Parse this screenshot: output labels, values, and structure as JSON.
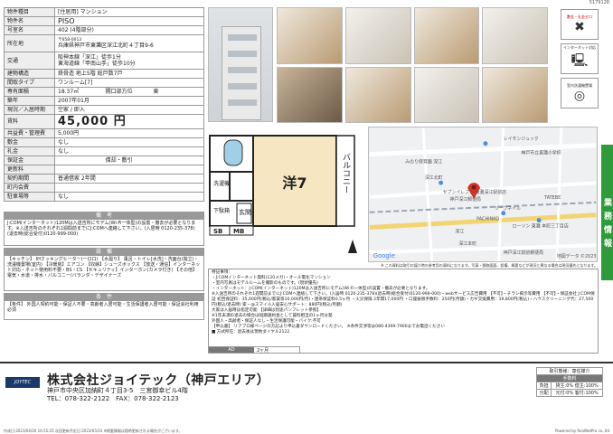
{
  "doc_code": "5179128",
  "spec": {
    "type_label": "物件種目",
    "type_value": "[住居用] マンション",
    "name_label": "物件名",
    "name_value": "PISO",
    "room_label": "号室名",
    "room_value": "402 (4階部分)",
    "address_label": "所在地",
    "postcode": "〒658-0013",
    "address_value": "兵庫県神戸市東灘区深江北町４丁目9-6",
    "access_label": "交通",
    "access_1": "阪神本線「深江」徒歩1分",
    "access_2": "東海道線「甲南山手」徒歩10分",
    "structure_label": "建物構造",
    "structure_value": "鉄骨造 地上5階 総戸数7戸",
    "layout_label": "間取タイプ",
    "layout_value": "ワンルーム[7]",
    "area_label": "専有面積",
    "area_value": "18.37㎡",
    "direction_label": "開口部方位",
    "direction_value": "東",
    "built_label": "築年",
    "built_value": "2007年01月",
    "status_label": "現況／入居時期",
    "status_value": "空家 / 即入",
    "rent_label": "賃料",
    "rent_value": "45,000 円",
    "fee_label": "共益費・管理費",
    "fee_value": "5,000円",
    "deposit_label": "敷金",
    "deposit_value": "なし",
    "key_label": "礼金",
    "key_value": "なし",
    "guarantee_label": "保証金",
    "offset_label": "償却・敷引",
    "renew_label": "更新料",
    "contract_label": "契約期間",
    "contract_value": "普通借家 2年間",
    "town_label": "町内会費",
    "parking_label": "駐車場等",
    "parking_value": "なし"
  },
  "notes": {
    "title": "備　考",
    "text": "J:COM(インターネット)120Mは入送吉所にモデム(Wi-Fi一体型)の設置・撤去が必要となります。※入送吉所のそれぞれ1週間前までにJ:COMへ連絡して下さい。(入居時 0120-235-378)(退去時(総合受付)0120-999-000)"
  },
  "equipment": {
    "title": "設　備",
    "text": "【キッチン】 IHクッキングヒーター(一口口) 【水廻り】 風呂・トイレ[水洗]・洗面台(独立)・洗濯機置場(室内) 【冷暖房】エアコン 【収納】シューズボックス 【放送・通信】インターネット対応・ネット使用料不要・BS・CS 【セキュリティ】インターホン(カメラ付き) 【その他】電気・水道・排水・バルコニー/バランダ・デザイナーズ"
  },
  "conditions": {
    "title": "条　件",
    "text": "【条件】 外国人契約可能・保証人不要・高齢者入居可能・生活保護者入居可能・保証会社利用必須"
  },
  "badges": {
    "deposit_key": "敷金・礼金ゼロ",
    "internet": "インターネット対応",
    "laundry": "室内洗濯機置場"
  },
  "side_tab": "業務情報",
  "plan": {
    "room": "洋7",
    "balcony": "バルコニー",
    "storage": "洗濯機",
    "closet": "下駄箱",
    "entrance": "玄関",
    "sb": "SB",
    "mb": "MB"
  },
  "map": {
    "labels": [
      "レイモンジュック",
      "神戸市立東灘小学校",
      "みのり保育園 深江",
      "深江北町",
      "セブンイレブン 東灘深江駅前店",
      "神戸深江郵便局",
      "リーブネイル",
      "PACHINKO",
      "深江",
      "ローソン 東灘 本町三丁目店",
      "TATEBE",
      "深江本町",
      "神戸深江駅前郵便局",
      "Google",
      "地図データ ©2023"
    ],
    "note": "※ この資料は取引の媒介時の参考用の資料になります。写真・間取図面、設備、概要などが現況と異なる場合は現況優先となります。"
  },
  "remarks": {
    "title": "特記事項：",
    "lines": [
      "・J:COMインターネット無料(120メガ)・オール電化マンション",
      "・室内写真はモデルルームを撮影のものです。(現状優先)",
      "・インターネット：J:COM(インターネット)120Mは入送吉所にモデム(Wi-Fi一体型)の設置・撤去が必要となります。",
      "※入送吉所のそれぞれ1週間前までにJ:COMへ連絡して下さい。(入居時 0120-235-378)(退去時(総合受付)0120-999-000)・webサービス広告費用 【不可】・チラシ掲示等費用 【不可】・保証会社 J:COM保証 初回保証料：35,000円(税込/家賃等10,000円/月)・連帯保証料0.5ヶ月 ・火災保険 2年間17,000円 ・口座振替手数料：250円(月額)・カギ交換費用：19,800円(税込)・ハウスクリーニング代：27,500円(税込/退去時) 家・@スマイル入居安心サポート：880円(税込/月額)",
      "大家は入居時は指定可能 【詳細は別途パンフレット参照】",
      "※1年未満の退去の場合は短期違約金として賃料相当の1ヶ月分発",
      "外国人・高齢者・保証人なし・生活保護可能・バイク:不可",
      "【申込書】 リアプロ様ページの方記より申込書ダウンロードください。 ※条件交渉等は080-4399-7900までお電話ください",
      "■ 方式所在：退去後は現地ダイヤル2122"
    ]
  },
  "ad": {
    "label": "AD",
    "value": "2ヶ月"
  },
  "footer": {
    "logo": "JOYTEC",
    "company": "株式会社ジョイテック（神戸エリア）",
    "address": "神戸市中央区加納町４丁目3-5　三宮御幸ビル4階",
    "tel": "TEL：078-322-2122　FAX：078-322-2123",
    "trade_title": "取引態様：専任媒介",
    "fee_title": "手数料",
    "row1_a": "負担",
    "row1_b": "貸主:0%  借主:100%",
    "row2_a": "分配",
    "row2_b": "元付:0%  客付:100%",
    "print_info": "作成日:2023/04/26 16:55:25  次回更新予定日:2023/05/10 ※掲載情報は随時更新される場合がございます。",
    "powered": "Powered by RealNetPro co.,ltd"
  }
}
